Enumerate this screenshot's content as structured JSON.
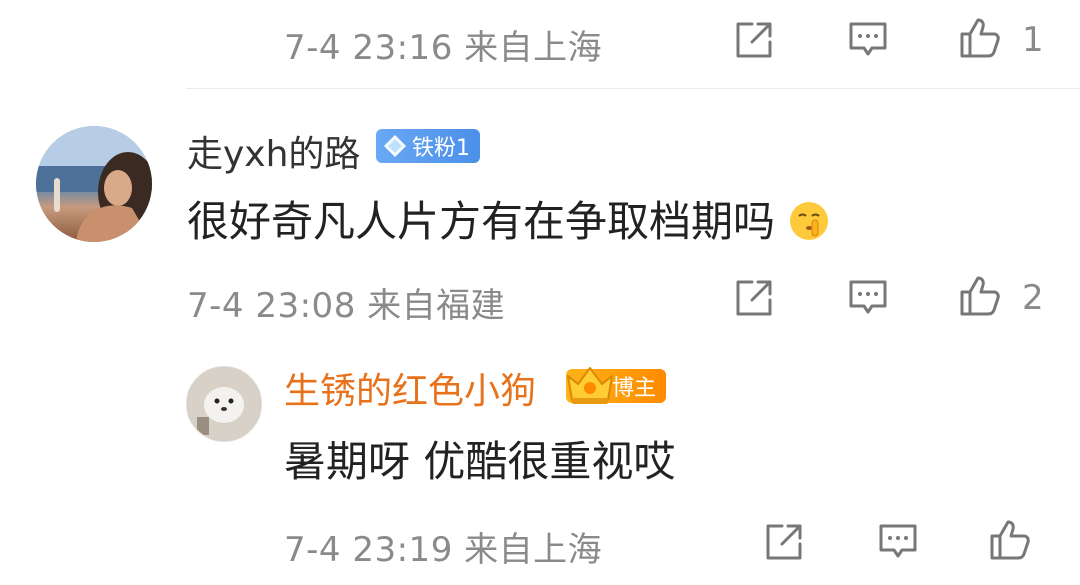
{
  "top_row": {
    "meta": "7-4 23:16 来自上海",
    "like_count": "1"
  },
  "comment_1": {
    "username": "走yxh的路",
    "badge": "铁粉1",
    "text": "很好奇凡人片方有在争取档期吗",
    "emoji_icon": "shush-emoji-icon",
    "meta": "7-4 23:08 来自福建",
    "like_count": "2"
  },
  "reply_1": {
    "username": "生锈的红色小狗",
    "badge": "博主",
    "text": "暑期呀 优酷很重视哎",
    "meta": "7-4 23:19 来自上海",
    "like_count": ""
  },
  "icons": {
    "share": "share-icon",
    "comment": "comment-icon",
    "like": "thumbs-up-icon"
  },
  "colors": {
    "meta_gray": "#8a8a8a",
    "blogger_name": "#e8711c",
    "fan_badge": "#5b9cf0",
    "blogger_badge": "#ff9a00"
  }
}
